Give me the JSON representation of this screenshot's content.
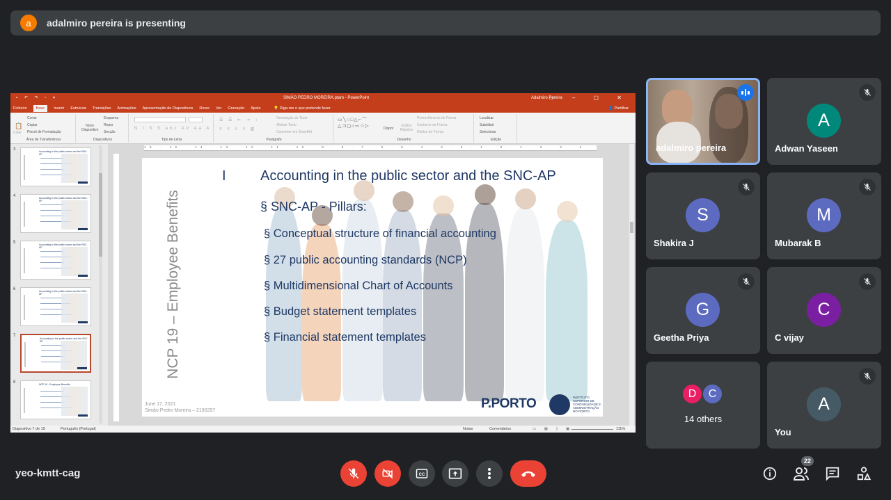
{
  "presenting": {
    "avatar_letter": "a",
    "text": "adalmiro pereira is presenting"
  },
  "powerpoint": {
    "window_title": "SIMÃO PEDRO MOREIRA.ptam - PowerPoint",
    "user": "Adalmiro Pereira",
    "tabs": [
      "Ficheiro",
      "Base",
      "Inserir",
      "Estrutura",
      "Transições",
      "Animações",
      "Apresentação de Diapositivos",
      "Rever",
      "Ver",
      "Gravação",
      "Ajuda"
    ],
    "tell_me": "Diga-me o que pretende fazer",
    "share": "Partilhar",
    "ribbon": {
      "clipboard_label": "Área de Transferência",
      "cut": "Cortar",
      "copy": "Copiar",
      "format_painter": "Pincel de Formatação",
      "paste": "Colar",
      "slides_label": "Diapositivos",
      "new_slide": "Novo Diapositivo",
      "layout": "Esquema",
      "reset": "Repor",
      "section": "Secção",
      "font_label": "Tipo de Letra",
      "paragraph_label": "Parágrafo",
      "text_direction": "Orientação do Texto",
      "align_text": "Alinhar Texto",
      "smartart": "Converter em SmartArt",
      "drawing_label": "Desenho",
      "arrange": "Dispor",
      "quick_styles": "Estilos Rápidos",
      "shape_fill": "Preenchimento de Forma",
      "shape_outline": "Contorno de Forma",
      "shape_effects": "Efeitos de Forma",
      "editing_label": "Edição",
      "find": "Localizar",
      "replace": "Substituir",
      "select": "Selecionar"
    },
    "thumbnails": [
      {
        "num": "3",
        "title": "Accounting in the public sector and the SNC-AP"
      },
      {
        "num": "4",
        "title": "Accounting in the public sector and the SNC-AP"
      },
      {
        "num": "5",
        "title": "Accounting in the public sector and the SNC-AP"
      },
      {
        "num": "6",
        "title": "Accounting in the public sector and the SNC-AP"
      },
      {
        "num": "7",
        "title": "Accounting in the public sector and the SNC-AP"
      },
      {
        "num": "8",
        "title": "NCP 19 - Employee Benefits"
      }
    ],
    "ruler_text": "16 · 15 · 14 · 13 · 12 · 11 · 10 · 9 · 8 · 7 · 6 · 5 · 4 · 3 · 2 · 1 · 0 · 1 · 2 · 3 · 4 · 5 · 6 · 7 · 8 · 9 · 10 · 11 · 12 · 13 · 14 · 15 · 16",
    "slide": {
      "side_title": "NCP 19 – Employee Benefits",
      "roman": "I",
      "title": "Accounting in the public sector and the SNC-AP",
      "subtitle": "§ SNC-AP - Pillars:",
      "bullets": [
        "§ Conceptual structure of financial accounting",
        "§ 27 public accounting standards (NCP)",
        "§ Multidimensional Chart of Accounts",
        "§ Budget statement templates",
        "§ Financial statement templates"
      ],
      "date": "June 17, 2021",
      "author": "Simão Pedro Moreira – 2190297",
      "logo": "P.PORTO",
      "logo_sub": "INSTITUTO SUPERIOR DE CONTABILIDADE E ADMINISTRAÇÃO DO PORTO"
    },
    "status": {
      "slide_count": "Diapositivo 7 de 19",
      "language": "Português (Portugal)",
      "notes": "Notas",
      "comments": "Comentários",
      "zoom": "111%"
    }
  },
  "participants": [
    {
      "name": "adalmiro pereira",
      "type": "video"
    },
    {
      "name": "Adwan Yaseen",
      "letter": "A",
      "color": "#00897b"
    },
    {
      "name": "Shakira J",
      "letter": "S",
      "color": "#5c6bc0"
    },
    {
      "name": "Mubarak B",
      "letter": "M",
      "color": "#5c6bc0"
    },
    {
      "name": "Geetha Priya",
      "letter": "G",
      "color": "#5c6bc0"
    },
    {
      "name": "C vijay",
      "letter": "C",
      "color": "#7b1fa2"
    },
    {
      "name": "You",
      "letter": "A",
      "color": "#455a64"
    }
  ],
  "others": {
    "avatars": [
      {
        "letter": "D",
        "color": "#e91e63"
      },
      {
        "letter": "C",
        "color": "#5c6bc0"
      }
    ],
    "label": "14 others"
  },
  "bottom_bar": {
    "meeting_code": "yeo-kmtt-cag",
    "participant_count": "22",
    "colors": {
      "red": "#ea4335",
      "grey": "#3c4043",
      "accent": "#8ab4f8"
    }
  }
}
